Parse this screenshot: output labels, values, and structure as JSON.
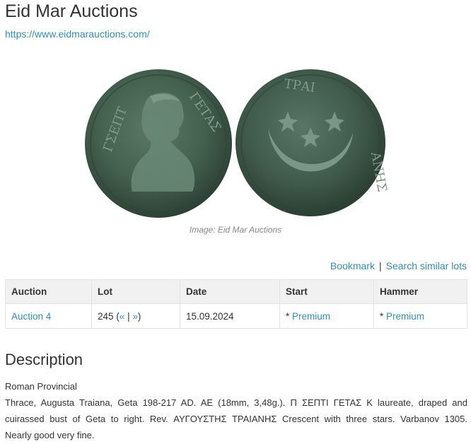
{
  "header": {
    "title": "Eid Mar Auctions",
    "url": "https://www.eidmarauctions.com/"
  },
  "image": {
    "caption": "Image: Eid Mar Auctions",
    "obverse_legend_left": "ΓΣΕΠΤ",
    "obverse_legend_right": "ΓΕΤΑΣ",
    "reverse_legend_top": "ΤΡΑΙ",
    "reverse_legend_right": "ΑΝΗΣ",
    "coin_color": "#3f5748"
  },
  "actions": {
    "bookmark": "Bookmark",
    "separator": "|",
    "search_similar": "Search similar lots"
  },
  "table": {
    "headers": [
      "Auction",
      "Lot",
      "Date",
      "Start",
      "Hammer"
    ],
    "row": {
      "auction": "Auction 4",
      "lot_number": "245",
      "lot_open": "(",
      "prev": "«",
      "mid_sep": "|",
      "next": "»",
      "lot_close": ")",
      "date": "15.09.2024",
      "start_prefix": "*",
      "start_link": "Premium",
      "hammer_prefix": "*",
      "hammer_link": "Premium"
    }
  },
  "description": {
    "title": "Description",
    "category": "Roman Provincial",
    "line1": "Thrace, Augusta Traiana, Geta 198-217 AD. AE (18mm, 3,48g.). Π ΣΕΠΤΙ ΓΕΤΑΣ Κ laureate, draped and",
    "line2": "cuirassed bust of Geta to right. Rev. ΑΥΓΟΥΣΤΗΣ ΤΡΑΙΑΝΗΣ Crescent with three stars. Varbanov 1305.",
    "line3": "Nearly good very fine."
  }
}
